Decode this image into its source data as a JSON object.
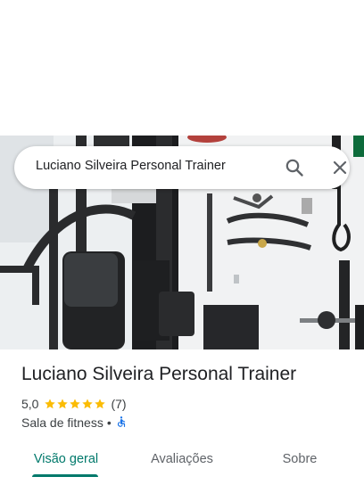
{
  "search": {
    "query": "Luciano Silveira Personal Trainer"
  },
  "place": {
    "title": "Luciano Silveira Personal Trainer",
    "rating": "5,0",
    "review_count": "(7)",
    "stars": 5,
    "category": "Sala de fitness",
    "separator": "•",
    "star_color": "#fbbc04",
    "accessibility_icon": "wheelchair-accessible-icon"
  },
  "tabs": [
    {
      "label": "Visão geral",
      "active": true
    },
    {
      "label": "Avaliações",
      "active": false
    },
    {
      "label": "Sobre",
      "active": false
    }
  ],
  "colors": {
    "accent": "#00796b",
    "accessibility": "#1a73e8"
  }
}
